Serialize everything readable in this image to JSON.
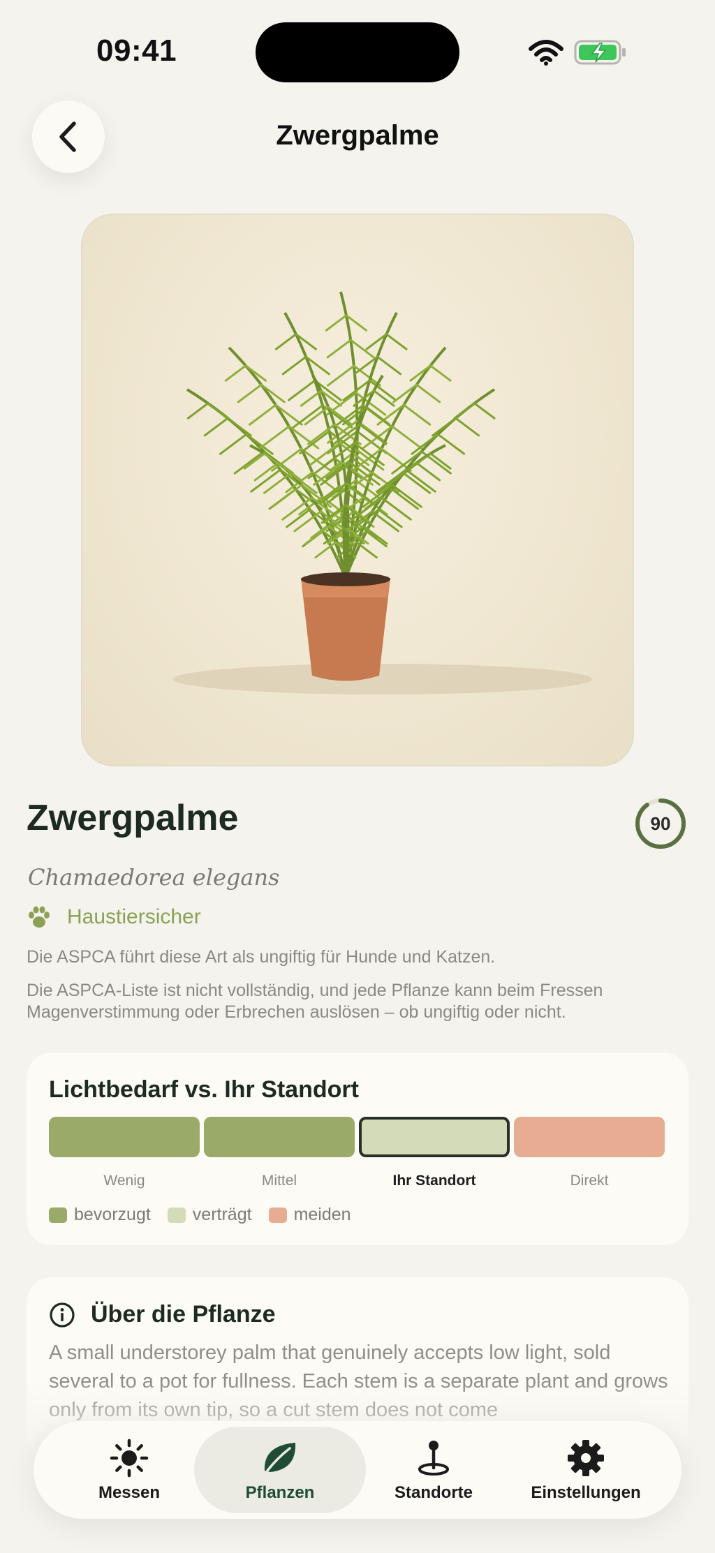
{
  "status_bar": {
    "time": "09:41"
  },
  "header": {
    "title": "Zwergpalme",
    "back_icon": "chevron-left-icon"
  },
  "plant": {
    "name": "Zwergpalme",
    "botanical_name": "Chamaedorea elegans",
    "score": "90",
    "score_fraction": 0.9,
    "pet_safe_label": "Haustiersicher",
    "aspca_note": "Die ASPCA führt diese Art als ungiftig für Hunde und Katzen.",
    "aspca_disclaimer": "Die ASPCA-Liste ist nicht vollständig, und jede Pflanze kann beim Fressen Magenverstimmung oder Erbrechen auslösen – ob ungiftig oder nicht."
  },
  "light": {
    "title": "Lichtbedarf vs. Ihr Standort",
    "levels": [
      {
        "label": "Wenig",
        "status": "bevorzugt",
        "current": false
      },
      {
        "label": "Mittel",
        "status": "bevorzugt",
        "current": false
      },
      {
        "label": "Ihr Standort",
        "status": "verträgt",
        "current": true
      },
      {
        "label": "Direkt",
        "status": "meiden",
        "current": false
      }
    ],
    "legend": [
      {
        "label": "bevorzugt",
        "color": "#9aaa68"
      },
      {
        "label": "verträgt",
        "color": "#d3dbb9"
      },
      {
        "label": "meiden",
        "color": "#e6ad93"
      }
    ]
  },
  "about": {
    "title": "Über die Pflanze",
    "text": "A small understorey palm that genuinely accepts low light, sold several to a pot for fullness. Each stem is a separate plant and grows only from its own tip, so a cut stem does not come"
  },
  "tabs": [
    {
      "label": "Messen",
      "icon": "sun-icon",
      "active": false
    },
    {
      "label": "Pflanzen",
      "icon": "leaf-icon",
      "active": true
    },
    {
      "label": "Standorte",
      "icon": "location-pin-icon",
      "active": false
    },
    {
      "label": "Einstellungen",
      "icon": "gear-icon",
      "active": false
    }
  ],
  "colors": {
    "accent": "#1f4d33",
    "pet_safe": "#8ba255",
    "background": "#f4f3ee"
  }
}
